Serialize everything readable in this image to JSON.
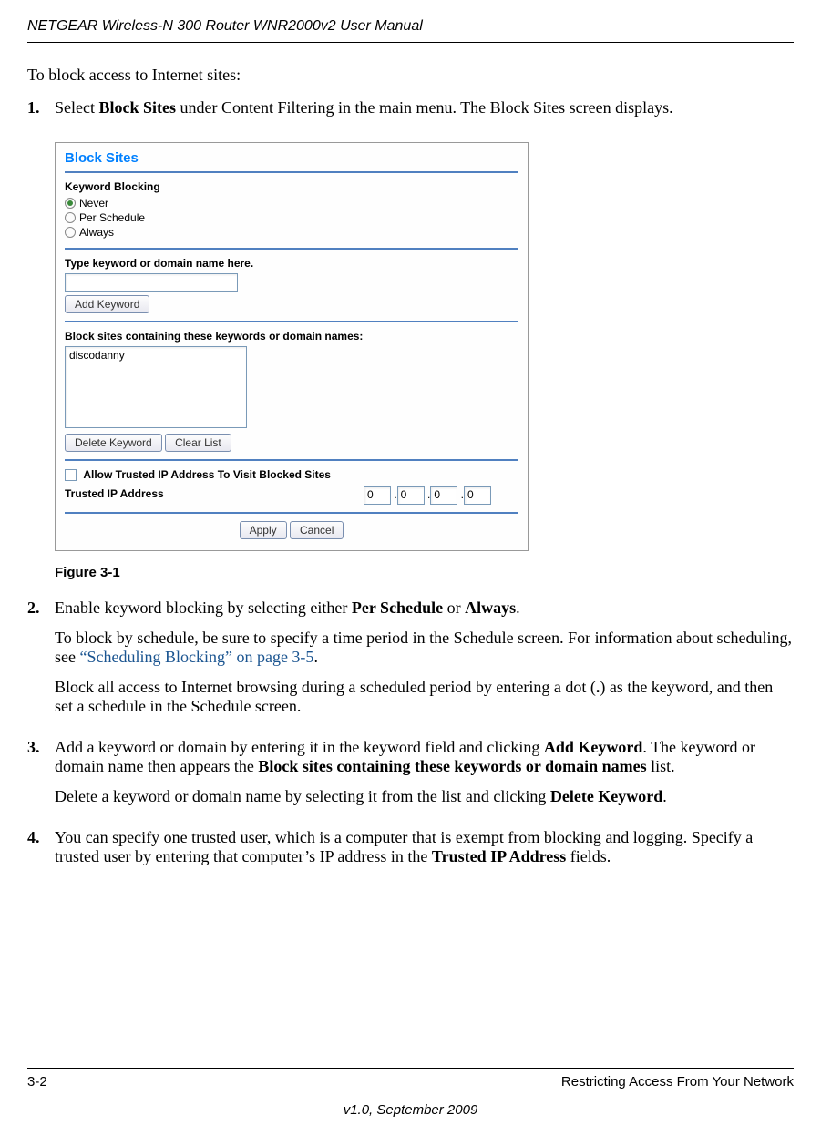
{
  "header": {
    "title": "NETGEAR Wireless-N 300 Router WNR2000v2 User Manual"
  },
  "intro": "To block access to Internet sites:",
  "steps": {
    "s1": {
      "num": "1.",
      "text_before": "Select ",
      "bold1": "Block Sites",
      "text_after": " under Content Filtering in the main menu. The Block Sites screen displays."
    },
    "s2": {
      "num": "2.",
      "p1_before": "Enable keyword blocking by selecting either ",
      "p1_bold1": "Per Schedule",
      "p1_mid": " or ",
      "p1_bold2": "Always",
      "p1_after": ".",
      "p2_before": "To block by schedule, be sure to specify a time period in the Schedule screen. For information about scheduling, see ",
      "p2_link": "“Scheduling Blocking” on page 3-5",
      "p2_after": ".",
      "p3_before": "Block all access to Internet browsing during a scheduled period by entering a dot (",
      "p3_bold": ".",
      "p3_after": ") as the keyword, and then set a schedule in the Schedule screen."
    },
    "s3": {
      "num": "3.",
      "p1_before": "Add a keyword or domain by entering it in the keyword field and clicking ",
      "p1_bold1": "Add Keyword",
      "p1_mid": ". The keyword or domain name then appears the ",
      "p1_bold2": "Block sites containing these keywords or domain names",
      "p1_after": " list.",
      "p2_before": "Delete a keyword or domain name by selecting it from the list and clicking ",
      "p2_bold": "Delete Keyword",
      "p2_after": "."
    },
    "s4": {
      "num": "4.",
      "p1_before": "You can specify one trusted user, which is a computer that is exempt from blocking and logging. Specify a trusted user by entering that computer’s IP address in the ",
      "p1_bold": "Trusted IP Address",
      "p1_after": " fields."
    }
  },
  "screenshot": {
    "title": "Block Sites",
    "keyword_blocking_label": "Keyword Blocking",
    "radios": {
      "never": "Never",
      "per_schedule": "Per Schedule",
      "always": "Always"
    },
    "type_keyword_label": "Type keyword or domain name here.",
    "add_keyword_btn": "Add Keyword",
    "block_list_label": "Block sites containing these keywords or domain names:",
    "list_item": "discodanny",
    "delete_keyword_btn": "Delete Keyword",
    "clear_list_btn": "Clear List",
    "allow_trusted_label": "Allow Trusted IP Address To Visit Blocked Sites",
    "trusted_ip_label": "Trusted IP Address",
    "ip": {
      "a": "0",
      "b": "0",
      "c": "0",
      "d": "0"
    },
    "apply_btn": "Apply",
    "cancel_btn": "Cancel"
  },
  "figure_label": "Figure 3-1",
  "footer": {
    "page": "3-2",
    "section": "Restricting Access From Your Network",
    "version": "v1.0, September 2009"
  }
}
